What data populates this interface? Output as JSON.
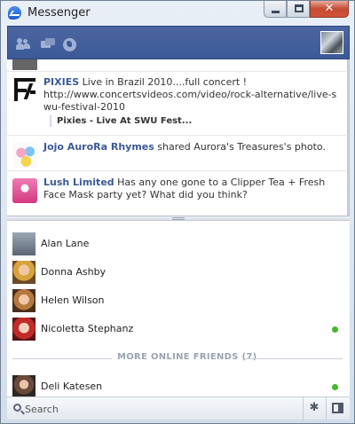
{
  "window": {
    "title": "Messenger",
    "close_glyph": "✕"
  },
  "header": {
    "icons": [
      "friends-icon",
      "messages-icon",
      "globe-icon"
    ]
  },
  "feed": {
    "items": [
      {
        "actor": "PIXIES",
        "text": " Live in Brazil 2010....full concert !",
        "link": "http://www.concertsvideos.com/video/rock-alternative/live-swu-festival-2010",
        "attachment": "Pixies - Live At SWU Fest..."
      },
      {
        "actor": "Jojo AuroRa Rhymes",
        "text": " shared Aurora's Treasures's photo."
      },
      {
        "actor": "Lush Limited",
        "text": " Has any one gone to a Clipper Tea + Fresh Face Mask party yet? What did you think?"
      }
    ]
  },
  "friends": {
    "list": [
      {
        "name": "Alan Lane",
        "online": false
      },
      {
        "name": "Donna Ashby",
        "online": false
      },
      {
        "name": "Helen Wilson",
        "online": false
      },
      {
        "name": "Nicoletta Stephanz",
        "online": true
      },
      {
        "name": "Deli Katesen",
        "online": true
      }
    ],
    "more_label": "MORE ONLINE FRIENDS (7)"
  },
  "bottom": {
    "search_placeholder": "Search",
    "gear_glyph": "✱"
  },
  "colors": {
    "header": "#3b5998",
    "online": "#42b72a",
    "link": "#3b5998"
  }
}
